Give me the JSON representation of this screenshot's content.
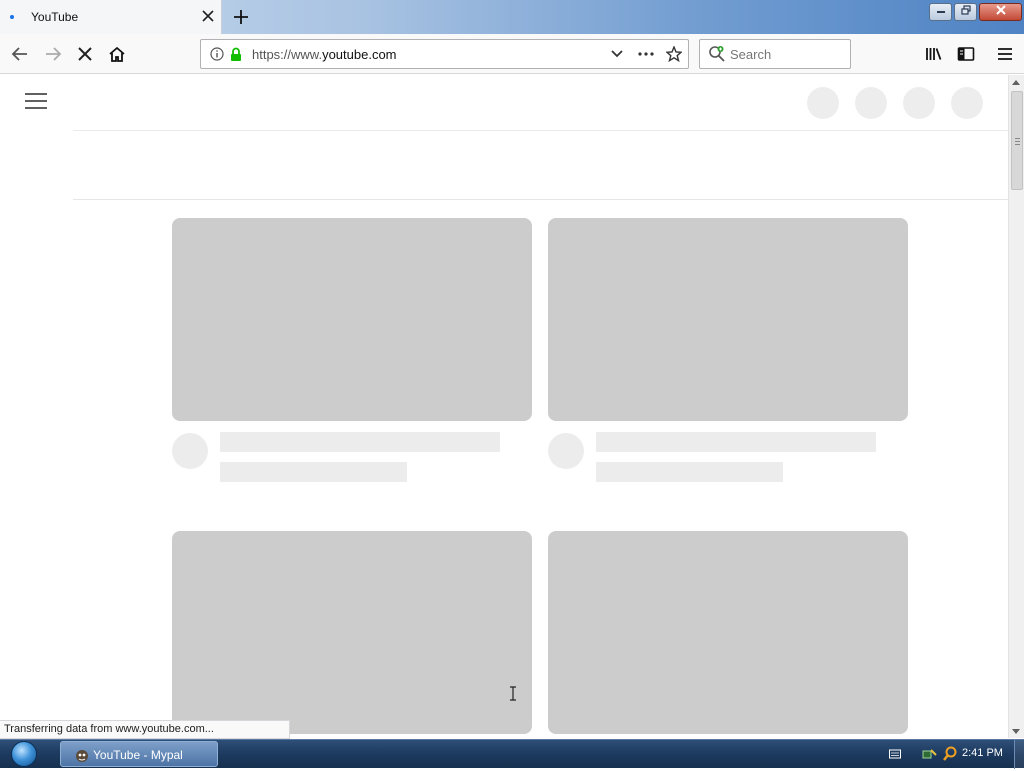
{
  "browser": {
    "tab": {
      "title": "YouTube",
      "close_icon": "close-icon"
    },
    "new_tab_icon": "plus-icon",
    "window_controls": [
      "minimize",
      "restore",
      "close"
    ],
    "navigation": {
      "back_icon": "arrow-left-icon",
      "forward_icon": "arrow-right-icon",
      "stop_icon": "close-x-icon",
      "home_icon": "home-icon"
    },
    "urlbar": {
      "info_icon": "info-icon",
      "lock_icon": "lock-icon",
      "scheme": "https://www.",
      "host": "youtube.com",
      "dropdown_icon": "chevron-down-icon",
      "page_actions_icon": "more-horizontal-icon",
      "bookmark_icon": "star-icon"
    },
    "searchbar": {
      "placeholder": "Search",
      "icon": "search-icon"
    },
    "toolbar_right": [
      "library-icon",
      "sidebar-icon",
      "menu-icon"
    ],
    "status_text": "Transferring data from www.youtube.com...",
    "lock_color": "#12bc00",
    "loading_dot_color": "#1a73e8"
  },
  "page": {
    "state": "loading-skeleton",
    "header_placeholders": 4,
    "video_placeholders": 4,
    "thumbnail_color": "#cccccc",
    "placeholder_color": "#ececec"
  },
  "taskbar": {
    "start_icon": "windows-start-icon",
    "task_label": "YouTube - Mypal",
    "tray_icons": [
      "keyboard-icon",
      "network-icon",
      "search-icon"
    ],
    "clock": "2:41 PM"
  }
}
